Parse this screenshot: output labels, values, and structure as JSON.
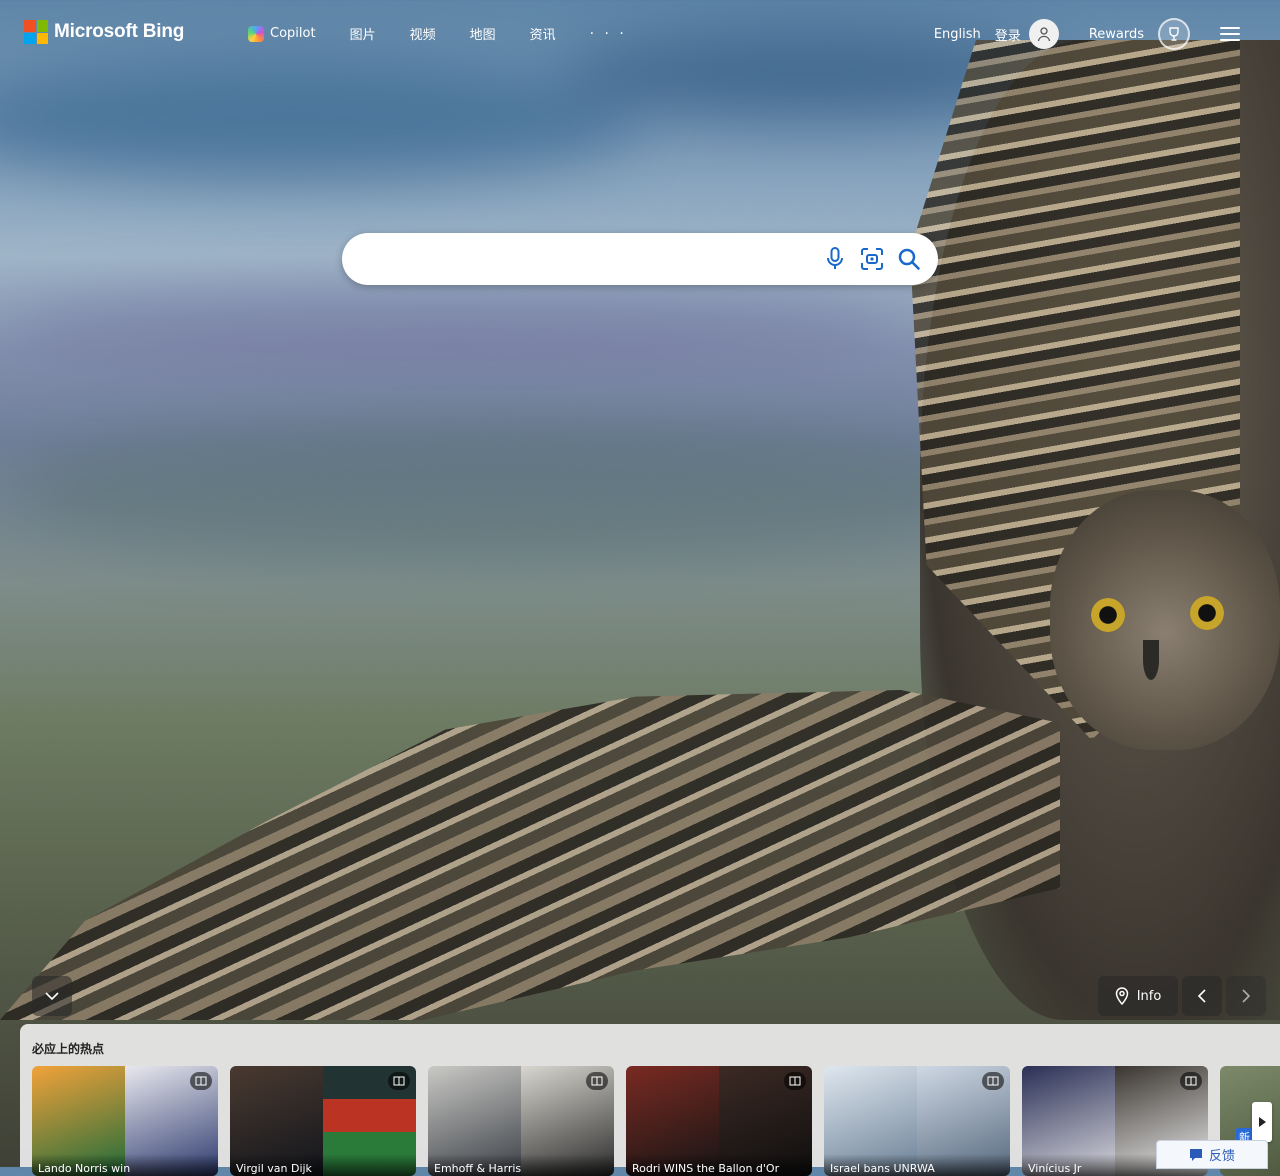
{
  "brand": {
    "logo_text": "Microsoft Bing"
  },
  "nav": {
    "items": [
      {
        "label": "Copilot",
        "icon": "copilot-icon"
      },
      {
        "label": "图片"
      },
      {
        "label": "视频"
      },
      {
        "label": "地图"
      },
      {
        "label": "资讯"
      }
    ],
    "more_label": "· · ·"
  },
  "header_right": {
    "language": "English",
    "signin": "登录",
    "rewards": "Rewards"
  },
  "search": {
    "placeholder": "",
    "value": ""
  },
  "controls": {
    "info_label": "Info"
  },
  "trending": {
    "title": "必应上的热点",
    "cards": [
      {
        "caption": "Lando Norris win"
      },
      {
        "caption": "Virgil van Dijk"
      },
      {
        "caption": "Emhoff & Harris"
      },
      {
        "caption": "Rodri WINS the Ballon d'Or"
      },
      {
        "caption": "Israel bans UNRWA"
      },
      {
        "caption": "Vinícius Jr"
      }
    ],
    "partial_badge": "新"
  },
  "feedback_label": "反馈",
  "colors": {
    "accent": "#2a5bb8",
    "search_icon": "#1a68c9"
  }
}
